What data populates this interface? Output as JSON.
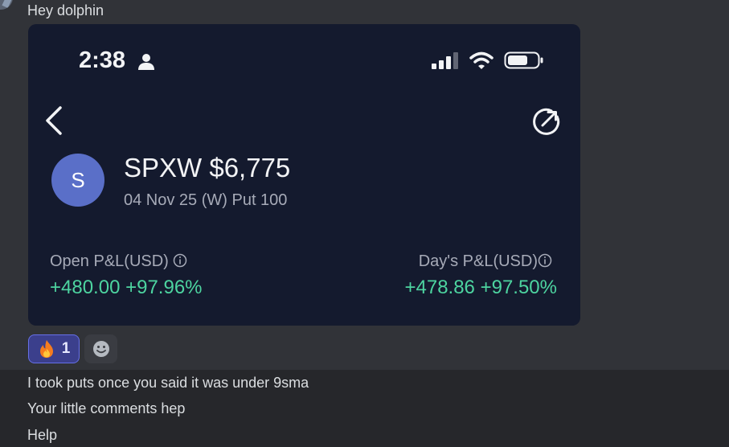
{
  "greeting": "Hey dolphin",
  "phone": {
    "status_time": "2:38",
    "ticker_initial": "S",
    "contract_title": "SPXW $6,775",
    "contract_subtitle": "04 Nov 25 (W) Put 100",
    "open_pl_label": "Open P&L(USD)",
    "open_pl_value": "+480.00 +97.96%",
    "day_pl_label": "Day's P&L(USD)",
    "day_pl_value": "+478.86 +97.50%",
    "accent_green": "#4dd4a0",
    "avatar_color": "#5a6fc8"
  },
  "reactions": {
    "fire_count": "1",
    "add_reaction_icon": "smiley-icon"
  },
  "messages": [
    "I took puts once you said it was under 9sma",
    "Your little comments hep",
    "Help"
  ]
}
